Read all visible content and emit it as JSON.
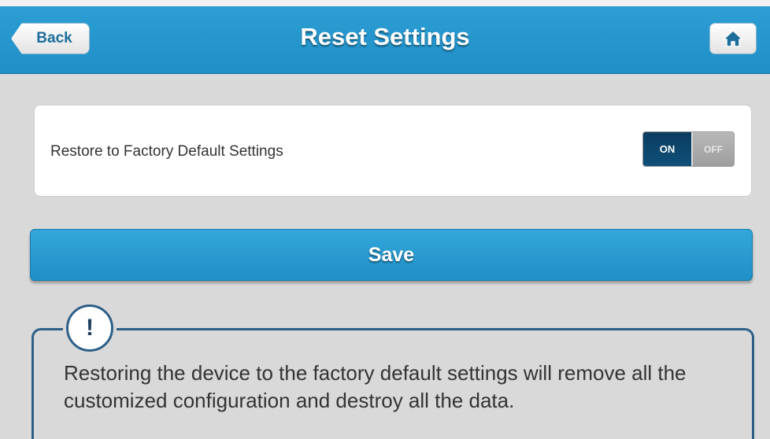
{
  "header": {
    "back_label": "Back",
    "title": "Reset Settings",
    "home_icon": "home-icon"
  },
  "settings": {
    "restore_label": "Restore to Factory Default Settings",
    "toggle": {
      "on_label": "ON",
      "off_label": "OFF",
      "state": "ON"
    }
  },
  "actions": {
    "save_label": "Save"
  },
  "warning": {
    "icon": "exclamation-icon",
    "icon_text": "!",
    "message": "Restoring the device to the factory default settings will remove all the customized configuration and destroy all the data."
  },
  "colors": {
    "accent": "#1f8fc6",
    "toggle_on": "#0f4f79",
    "warning_border": "#2e5f88",
    "background": "#d9d9d9"
  }
}
